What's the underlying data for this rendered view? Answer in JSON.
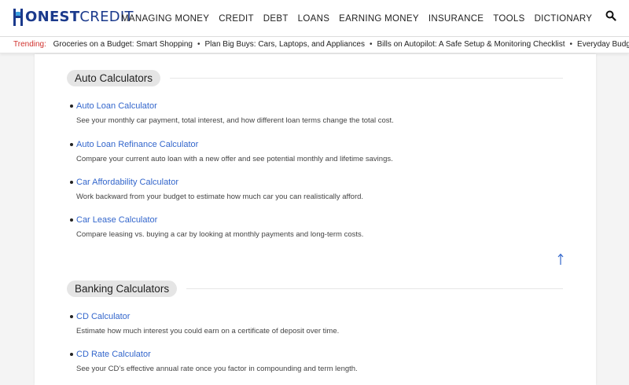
{
  "brand": {
    "logo_bold": "ONEST",
    "logo_light": "CREDIT"
  },
  "nav": [
    "MANAGING MONEY",
    "CREDIT",
    "DEBT",
    "LOANS",
    "EARNING MONEY",
    "INSURANCE",
    "TOOLS",
    "DICTIONARY"
  ],
  "trending": {
    "label": "Trending:",
    "items": [
      "Groceries on a Budget: Smart Shopping",
      "Plan Big Buys: Cars, Laptops, and Appliances",
      "Bills on Autopilot: A Safe Setup & Monitoring Checklist",
      "Everyday Budget Apps: What..."
    ]
  },
  "sections": [
    {
      "title": "Auto Calculators",
      "items": [
        {
          "title": "Auto Loan Calculator",
          "desc": "See your monthly car payment, total interest, and how different loan terms change the total cost."
        },
        {
          "title": "Auto Loan Refinance Calculator",
          "desc": "Compare your current auto loan with a new offer and see potential monthly and lifetime savings."
        },
        {
          "title": "Car Affordability Calculator",
          "desc": "Work backward from your budget to estimate how much car you can realistically afford."
        },
        {
          "title": "Car Lease Calculator",
          "desc": "Compare leasing vs. buying a car by looking at monthly payments and long-term costs."
        }
      ]
    },
    {
      "title": "Banking Calculators",
      "items": [
        {
          "title": "CD Calculator",
          "desc": "Estimate how much interest you could earn on a certificate of deposit over time."
        },
        {
          "title": "CD Rate Calculator",
          "desc": "See your CD’s effective annual rate once you factor in compounding and term length."
        }
      ]
    }
  ],
  "icons": {
    "search": "search-icon",
    "back_to_top": "arrow-up-icon"
  },
  "colors": {
    "brand": "#1b3a8c",
    "link": "#3366cc",
    "trending": "#d0312d",
    "pill": "#e5e5e5"
  }
}
